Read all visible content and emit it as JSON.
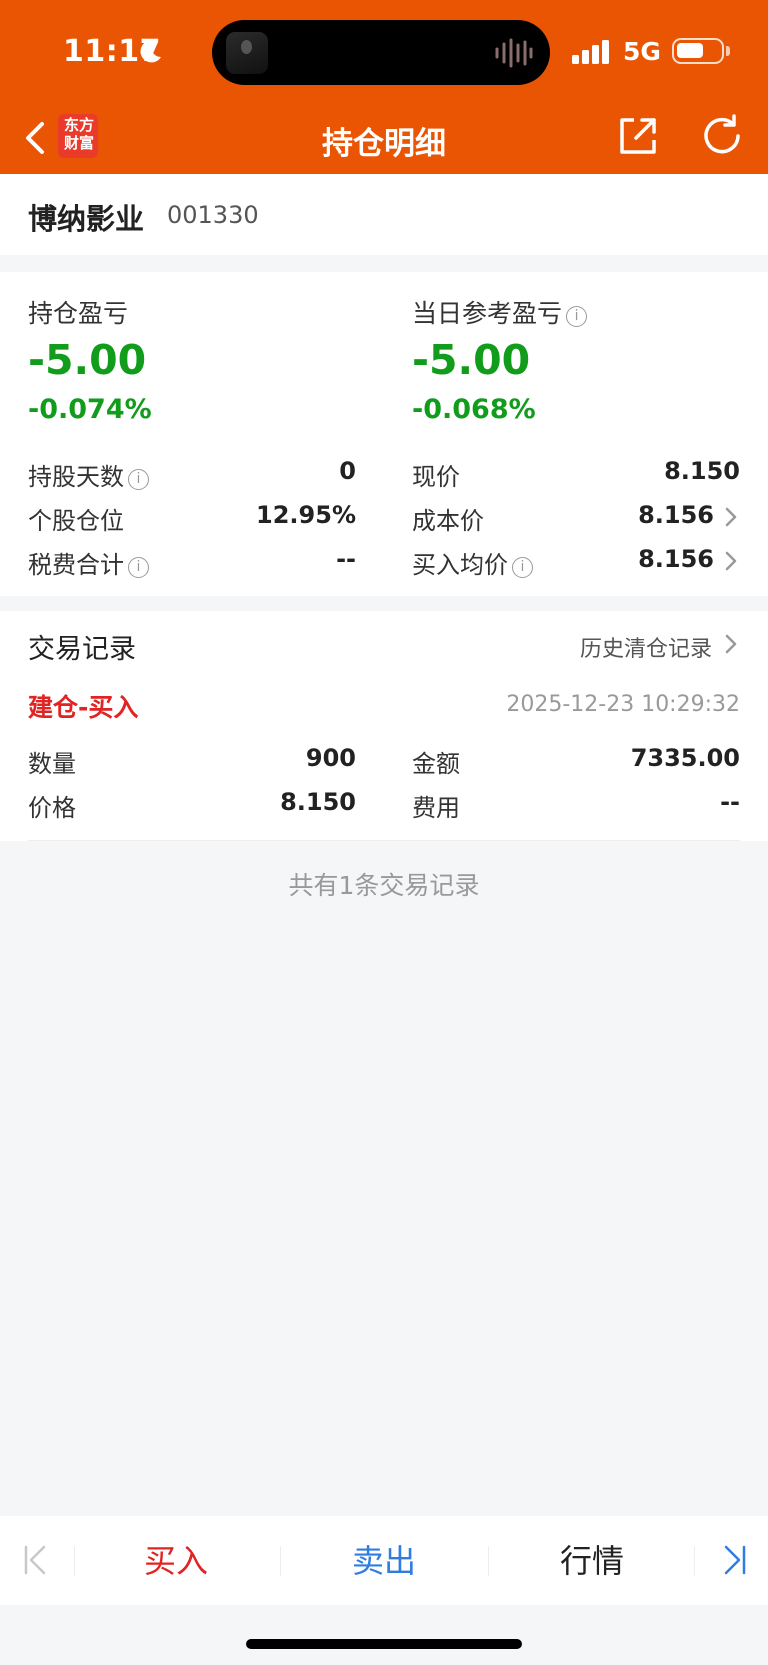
{
  "status_bar": {
    "time": "11:17",
    "network": "5G"
  },
  "nav": {
    "logo_line1": "东方",
    "logo_line2": "财富",
    "title": "持仓明细",
    "icons": [
      "back-arrow-icon",
      "share-icon",
      "refresh-icon"
    ]
  },
  "stock": {
    "name": "博纳影业",
    "code": "001330"
  },
  "position": {
    "holding_pl_label": "持仓盈亏",
    "holding_pl_value": "-5.00",
    "holding_pl_pct": "-0.074%",
    "daily_pl_label": "当日参考盈亏",
    "daily_pl_value": "-5.00",
    "daily_pl_pct": "-0.068%",
    "rows_left": [
      {
        "label": "持股天数",
        "value": "0"
      },
      {
        "label": "个股仓位",
        "value": "12.95%"
      },
      {
        "label": "税费合计",
        "value": "--"
      }
    ],
    "rows_right": [
      {
        "label": "现价",
        "value": "8.150"
      },
      {
        "label": "成本价",
        "value": "8.156"
      },
      {
        "label": "买入均价",
        "value": "8.156"
      }
    ],
    "colors": {
      "loss": "#119c1b",
      "buy": "#e02323",
      "sell": "#2f7de1",
      "header": "#ea5504"
    }
  },
  "trades": {
    "title": "交易记录",
    "history_link": "历史清仓记录",
    "record": {
      "type": "建仓-买入",
      "time": "2025-12-23 10:29:32",
      "quantity_label": "数量",
      "quantity": "900",
      "amount_label": "金额",
      "amount": "7335.00",
      "price_label": "价格",
      "price": "8.150",
      "fee_label": "费用",
      "fee": "--"
    },
    "count_text": "共有1条交易记录"
  },
  "toolbar": {
    "buy": "买入",
    "sell": "卖出",
    "quote": "行情"
  }
}
